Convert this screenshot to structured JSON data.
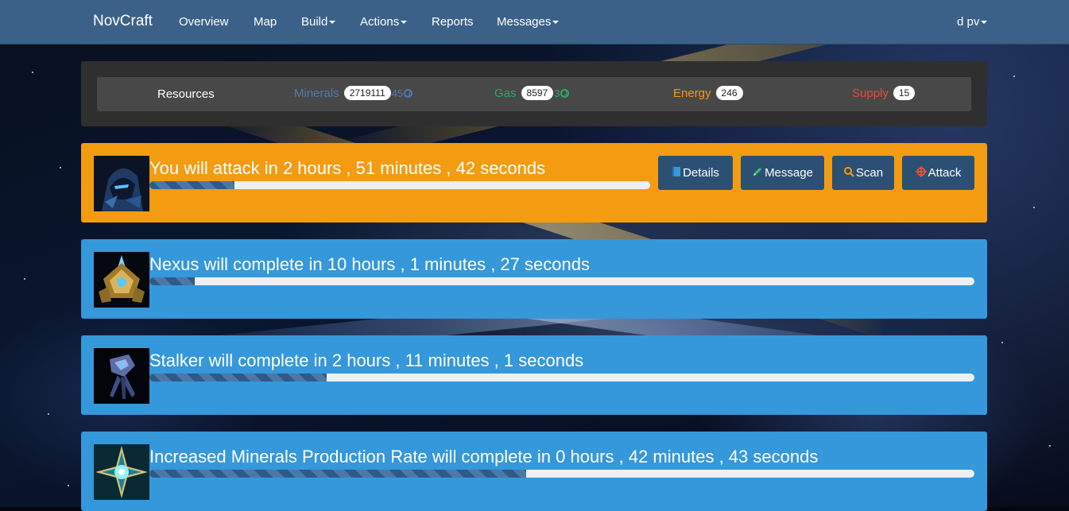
{
  "nav": {
    "brand": "NovCraft",
    "items": [
      "Overview",
      "Map",
      "Build",
      "Actions",
      "Reports",
      "Messages"
    ],
    "user": "d pv"
  },
  "resources": {
    "title": "Resources",
    "minerals": {
      "label": "Minerals",
      "value": "2719111",
      "rate": "45",
      "color": "#4f7bb1",
      "rate_icon": "clock-icon"
    },
    "gas": {
      "label": "Gas",
      "value": "8597",
      "rate": "3",
      "color": "#27ae60",
      "rate_icon": "clock-icon"
    },
    "energy": {
      "label": "Energy",
      "value": "246",
      "color": "#f39c12"
    },
    "supply": {
      "label": "Supply",
      "value": "15",
      "color": "#e74c3c"
    }
  },
  "attack": {
    "text": "You will attack in 2 hours , 51 minutes , 42 seconds",
    "progress": 0.17,
    "color": "#f39c12",
    "buttons": [
      {
        "label": "Details",
        "icon": "book-icon"
      },
      {
        "label": "Message",
        "icon": "pencil-icon"
      },
      {
        "label": "Scan",
        "icon": "search-icon"
      },
      {
        "label": "Attack",
        "icon": "crosshair-icon"
      }
    ]
  },
  "queue": [
    {
      "text": "Nexus will complete in 10 hours , 1 minutes , 27 seconds",
      "progress": 0.055,
      "icon": "nexus-portrait"
    },
    {
      "text": "Stalker will complete in 2 hours , 11 minutes , 1 seconds",
      "progress": 0.215,
      "icon": "stalker-portrait"
    },
    {
      "text": "Increased Minerals Production Rate will complete in 0 hours , 42 minutes , 43 seconds",
      "progress": 0.457,
      "icon": "upgrade-portrait"
    }
  ]
}
